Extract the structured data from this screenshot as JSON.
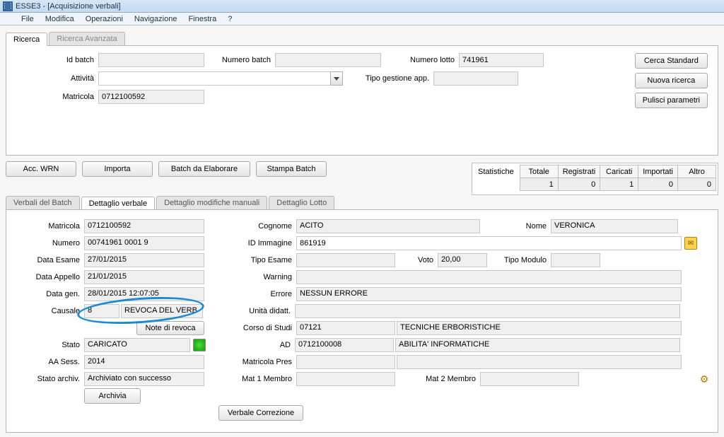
{
  "window": {
    "title": "ESSE3 - [Acquisizione verbali]"
  },
  "menu": {
    "file": "File",
    "modifica": "Modifica",
    "operazioni": "Operazioni",
    "navigazione": "Navigazione",
    "finestra": "Finestra",
    "help": "?"
  },
  "search_tabs": {
    "ricerca": "Ricerca",
    "avanzata": "Ricerca Avanzata"
  },
  "search": {
    "id_batch_lbl": "Id batch",
    "id_batch": "",
    "numero_batch_lbl": "Numero batch",
    "numero_batch": "",
    "numero_lotto_lbl": "Numero lotto",
    "numero_lotto": "741961",
    "attivita_lbl": "Attività",
    "attivita": "",
    "tipo_gest_lbl": "Tipo gestione app.",
    "tipo_gest": "",
    "matricola_lbl": "Matricola",
    "matricola": "0712100592"
  },
  "side_btn": {
    "cerca": "Cerca Standard",
    "nuova": "Nuova ricerca",
    "pulisci": "Pulisci parametri"
  },
  "mid_btn": {
    "acc": "Acc. WRN",
    "importa": "Importa",
    "batch_el": "Batch da Elaborare",
    "stampa": "Stampa Batch"
  },
  "stats": {
    "label": "Statistiche",
    "cols": {
      "totale": "Totale",
      "registrati": "Registrati",
      "caricati": "Caricati",
      "importati": "Importati",
      "altro": "Altro"
    },
    "vals": {
      "totale": "1",
      "registrati": "0",
      "caricati": "1",
      "importati": "0",
      "altro": "0"
    }
  },
  "detail_tabs": {
    "verbali": "Verbali del Batch",
    "dettaglio": "Dettaglio verbale",
    "modifiche": "Dettaglio modifiche manuali",
    "lotto": "Dettaglio Lotto"
  },
  "d": {
    "matricola_lbl": "Matricola",
    "matricola": "0712100592",
    "cognome_lbl": "Cognome",
    "cognome": "ACITO",
    "nome_lbl": "Nome",
    "nome": "VERONICA",
    "numero_lbl": "Numero",
    "numero": "00741961 0001 9",
    "id_imm_lbl": "ID Immagine",
    "id_imm": "861919",
    "data_esame_lbl": "Data Esame",
    "data_esame": "27/01/2015",
    "tipo_esame_lbl": "Tipo Esame",
    "tipo_esame": "",
    "voto_lbl": "Voto",
    "voto": "20,00",
    "tipo_modulo_lbl": "Tipo Modulo",
    "tipo_modulo": "",
    "data_appello_lbl": "Data Appello",
    "data_appello": "21/01/2015",
    "warning_lbl": "Warning",
    "warning": "",
    "data_gen_lbl": "Data gen.",
    "data_gen": "28/01/2015 12:07:05",
    "errore_lbl": "Errore",
    "errore": "NESSUN ERRORE",
    "causale_lbl": "Causale",
    "causale_code": "8",
    "causale_desc": "REVOCA DEL VERB",
    "note_revoca_btn": "Note di revoca",
    "unita_lbl": "Unità didatt.",
    "unita": "",
    "corso_lbl": "Corso di Studi",
    "corso_code": "07121",
    "corso_desc": "TECNICHE ERBORISTICHE",
    "stato_lbl": "Stato",
    "stato": "CARICATO",
    "ad_lbl": "AD",
    "ad_code": "0712100008",
    "ad_desc": "ABILITA' INFORMATICHE",
    "aa_lbl": "AA Sess.",
    "aa": "2014",
    "mat_pres_lbl": "Matricola Pres",
    "mat_pres": "",
    "stato_arch_lbl": "Stato archiv.",
    "stato_arch": "Archiviato con successo",
    "mat1_lbl": "Mat 1 Membro",
    "mat1": "",
    "mat2_lbl": "Mat 2 Membro",
    "mat2": "",
    "archivia_btn": "Archivia",
    "verbale_corr_btn": "Verbale Correzione"
  }
}
